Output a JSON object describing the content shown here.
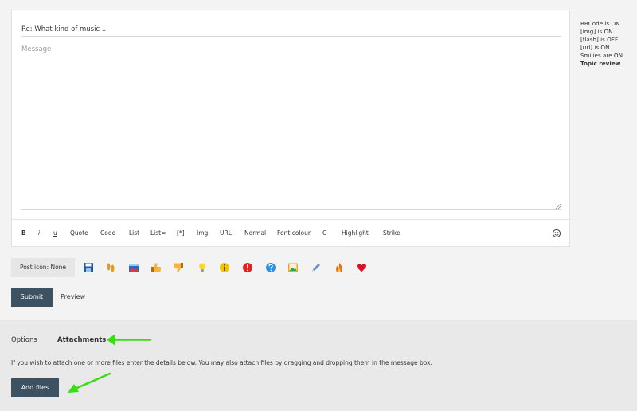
{
  "editor": {
    "subject_value": "Re: What kind of music ...",
    "message_placeholder": "Message"
  },
  "toolbar": {
    "buttons": [
      {
        "name": "bold-button",
        "label": "B"
      },
      {
        "name": "italic-button",
        "label": "i"
      },
      {
        "name": "underline-button",
        "label": "u"
      },
      {
        "name": "quote-button",
        "label": "Quote"
      },
      {
        "name": "code-button",
        "label": "Code"
      },
      {
        "name": "list-button",
        "label": "List"
      },
      {
        "name": "ordered-list-button",
        "label": "List="
      },
      {
        "name": "list-item-button",
        "label": "[*]"
      },
      {
        "name": "img-button",
        "label": "Img"
      },
      {
        "name": "url-button",
        "label": "URL"
      },
      {
        "name": "font-size-button",
        "label": "Normal"
      },
      {
        "name": "font-colour-button",
        "label": "Font colour"
      },
      {
        "name": "c-button",
        "label": "C"
      },
      {
        "name": "highlight-button",
        "label": "Highlight"
      },
      {
        "name": "strike-button",
        "label": "Strike"
      }
    ],
    "smiley_icon": "smiley-icon"
  },
  "status_panel": {
    "lines": [
      "BBCode is ON",
      "[img] is ON",
      "[flash] is OFF",
      "[url] is ON",
      "Smilies are ON"
    ],
    "topic_review": "Topic review"
  },
  "post_icon": {
    "label": "Post icon: None",
    "icons": [
      "floppy-disk-icon",
      "footprints-icon",
      "picture-icon",
      "thumbs-up-icon",
      "thumbs-down-icon",
      "lightbulb-icon",
      "info-icon",
      "exclamation-icon",
      "question-icon",
      "image-icon",
      "pencil-icon",
      "fire-icon",
      "heart-icon"
    ]
  },
  "actions": {
    "submit_label": "Submit",
    "preview_label": "Preview"
  },
  "bottom": {
    "tabs": [
      "Options",
      "Attachments"
    ],
    "active_tab": "Attachments",
    "info_text": "If you wish to attach one or more files enter the details below. You may also attach files by dragging and dropping them in the message box.",
    "add_files_label": "Add files"
  },
  "colors": {
    "primary_button": "#3c5263",
    "arrow": "#3cdc14"
  }
}
